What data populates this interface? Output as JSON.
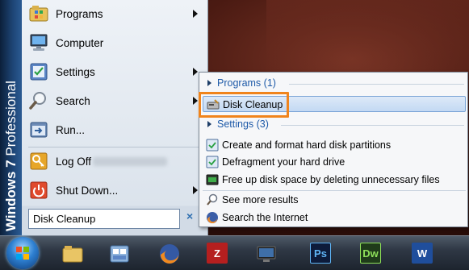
{
  "os_banner": {
    "product": "Windows 7",
    "edition": "Professional"
  },
  "start_menu": {
    "items": [
      {
        "label": "Programs",
        "icon": "programs-folder-icon",
        "has_submenu": true
      },
      {
        "label": "Computer",
        "icon": "computer-icon",
        "has_submenu": false
      },
      {
        "label": "Settings",
        "icon": "settings-control-panel-icon",
        "has_submenu": true
      },
      {
        "label": "Search",
        "icon": "search-magnifier-icon",
        "has_submenu": true
      },
      {
        "label": "Run...",
        "icon": "run-icon",
        "has_submenu": false
      },
      {
        "label": "Log Off",
        "icon": "key-icon",
        "has_submenu": false
      },
      {
        "label": "Shut Down...",
        "icon": "power-icon",
        "has_submenu": true
      }
    ],
    "search_value": "Disk Cleanup",
    "clear_symbol": "×"
  },
  "results": {
    "programs_header": "Programs (1)",
    "program_items": [
      {
        "label": "Disk Cleanup",
        "icon": "disk-cleanup-icon",
        "selected": true
      }
    ],
    "settings_header": "Settings (3)",
    "settings_items": [
      {
        "label": "Create and format hard disk partitions",
        "icon": "control-panel-icon"
      },
      {
        "label": "Defragment your hard drive",
        "icon": "control-panel-icon"
      },
      {
        "label": "Free up disk space by deleting unnecessary files",
        "icon": "disk-space-icon"
      }
    ],
    "more_results": "See more results",
    "search_internet": "Search the Internet"
  },
  "taskbar": {
    "apps": [
      "start-orb",
      "file-explorer",
      "control-panel",
      "firefox",
      "filezilla",
      "monitor",
      "photoshop",
      "dreamweaver",
      "word"
    ],
    "app_letters": {
      "filezilla": "Z",
      "photoshop": "Ps",
      "dreamweaver": "Dw",
      "word": "W"
    },
    "colors": {
      "filezilla": "#b51f1f",
      "photoshop": "#0d1b3a",
      "dreamweaver": "#1f3b1a",
      "word": "#1f4e9c",
      "highlight": "#f0841c"
    }
  }
}
